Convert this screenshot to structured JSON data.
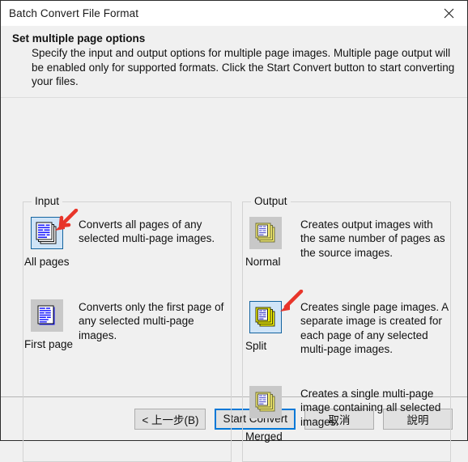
{
  "window": {
    "title": "Batch Convert File Format",
    "close_icon": "close-icon"
  },
  "header": {
    "title": "Set multiple page options",
    "description": "Specify the input and output options for multiple page images. Multiple page output will be enabled only for supported formats. Click the Start Convert button to start converting your files."
  },
  "input_group": {
    "legend": "Input",
    "options": [
      {
        "label": "All pages",
        "description": "Converts all pages of any selected multi-page images.",
        "icon": "all-pages-icon",
        "selected": true,
        "annotated": true
      },
      {
        "label": "First page",
        "description": "Converts only the first page of any selected multi-page images.",
        "icon": "first-page-icon",
        "selected": false,
        "annotated": false
      }
    ]
  },
  "output_group": {
    "legend": "Output",
    "options": [
      {
        "label": "Normal",
        "description": "Creates output images with the same number of pages as the source images.",
        "icon": "normal-pages-icon",
        "selected": false,
        "annotated": false
      },
      {
        "label": "Split",
        "description": "Creates single page images. A separate image is created for each page of any selected multi-page images.",
        "icon": "split-pages-icon",
        "selected": true,
        "annotated": true
      },
      {
        "label": "Merged",
        "description": "Creates a single multi-page image containing all selected images.",
        "icon": "merged-pages-icon",
        "selected": false,
        "annotated": false
      }
    ]
  },
  "footer": {
    "back_label": "< 上一步(B)",
    "start_label": "Start Convert",
    "cancel_label": "取消",
    "help_label": "說明"
  },
  "colors": {
    "accent": "#0078d7",
    "selection_border": "#1464a0",
    "selection_fill": "#cfe4f7",
    "icon_button_bg": "#c8c8c8",
    "annotation_arrow": "#e8352a",
    "doc_line_blue": "#1a1aff",
    "page_yellow": "#f2ea6e"
  }
}
